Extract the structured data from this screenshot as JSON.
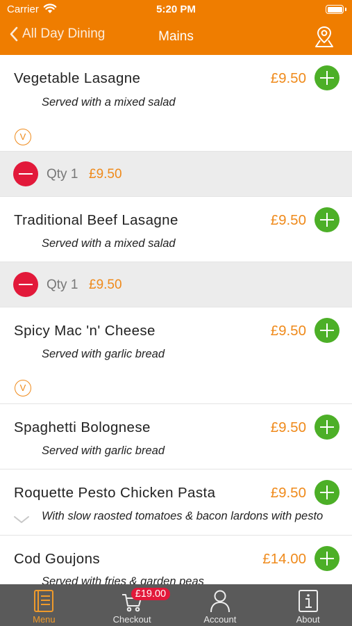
{
  "status_bar": {
    "carrier": "Carrier",
    "time": "5:20 PM"
  },
  "nav": {
    "back_label": "All Day Dining",
    "title": "Mains",
    "map_icon": "map-pin-icon"
  },
  "items": [
    {
      "name": "Vegetable Lasagne",
      "price": "£9.50",
      "description": "Served with a mixed salad",
      "veg_badge": "V",
      "qty_label": "Qty 1",
      "qty_price": "£9.50"
    },
    {
      "name": "Traditional Beef Lasagne",
      "price": "£9.50",
      "description": "Served with a mixed salad",
      "qty_label": "Qty 1",
      "qty_price": "£9.50"
    },
    {
      "name": "Spicy Mac 'n' Cheese",
      "price": "£9.50",
      "description": "Served with garlic bread",
      "veg_badge": "V"
    },
    {
      "name": "Spaghetti Bolognese",
      "price": "£9.50",
      "description": "Served with garlic bread"
    },
    {
      "name": "Roquette Pesto Chicken Pasta",
      "price": "£9.50",
      "description": "With slow raosted tomatoes & bacon lardons with pesto"
    },
    {
      "name": "Cod Goujons",
      "price": "£14.00",
      "description": "Served with fries & garden peas"
    }
  ],
  "tabbar": {
    "menu": "Menu",
    "checkout": "Checkout",
    "checkout_badge": "£19.00",
    "account": "Account",
    "about": "About"
  },
  "colors": {
    "brand": "#ef7d00",
    "price": "#ef8a1b",
    "add": "#4caf27",
    "remove": "#e2193a",
    "tabbar": "#5a5a5a"
  }
}
